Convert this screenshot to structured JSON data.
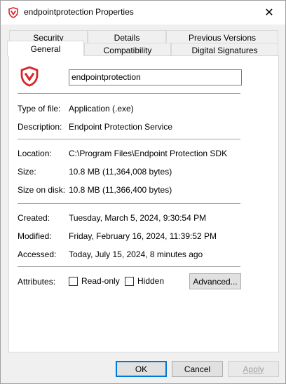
{
  "window": {
    "title": "endpointprotection Properties",
    "close_glyph": "✕",
    "brand_color": "#d9252b"
  },
  "tabs": {
    "row1": [
      {
        "label": "Security"
      },
      {
        "label": "Details"
      },
      {
        "label": "Previous Versions"
      }
    ],
    "row2": [
      {
        "label": "General",
        "active": true
      },
      {
        "label": "Compatibility"
      },
      {
        "label": "Digital Signatures"
      }
    ]
  },
  "general": {
    "file_name": "endpointprotection",
    "type_label": "Type of file:",
    "type_value": "Application (.exe)",
    "description_label": "Description:",
    "description_value": "Endpoint Protection Service",
    "location_label": "Location:",
    "location_value": "C:\\Program Files\\Endpoint Protection SDK",
    "size_label": "Size:",
    "size_value": "10.8 MB (11,364,008 bytes)",
    "size_on_disk_label": "Size on disk:",
    "size_on_disk_value": "10.8 MB (11,366,400 bytes)",
    "created_label": "Created:",
    "created_value": "Tuesday, March 5, 2024, 9:30:54 PM",
    "modified_label": "Modified:",
    "modified_value": "Friday, February 16, 2024, 11:39:52 PM",
    "accessed_label": "Accessed:",
    "accessed_value": "Today, July 15, 2024, 8 minutes ago",
    "attributes_label": "Attributes:",
    "readonly_label": "Read-only",
    "hidden_label": "Hidden",
    "advanced_label": "Advanced..."
  },
  "footer": {
    "ok_label": "OK",
    "cancel_label": "Cancel",
    "apply_label": "Apply"
  }
}
